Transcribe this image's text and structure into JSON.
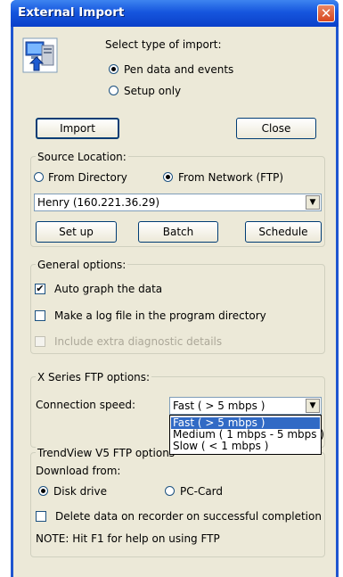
{
  "window": {
    "title": "External Import",
    "close_glyph": "✕"
  },
  "import_type": {
    "prompt": "Select type of import:",
    "options": [
      "Pen data and events",
      "Setup only"
    ],
    "selected": 0
  },
  "buttons": {
    "import": "Import",
    "close": "Close"
  },
  "source_location": {
    "label": "Source Location:",
    "from_directory": "From Directory",
    "from_network": "From Network (FTP)",
    "selected": "from_network",
    "server": "Henry (160.221.36.29)",
    "setup_btn": "Set up",
    "batch_btn": "Batch",
    "schedule_btn": "Schedule"
  },
  "general_options": {
    "label": "General options:",
    "auto_graph": {
      "label": "Auto graph the data",
      "checked": true
    },
    "log_file": {
      "label": "Make a log file in the program directory",
      "checked": false
    },
    "extra_diag": {
      "label": "Include extra diagnostic details",
      "checked": false,
      "disabled": true
    }
  },
  "x_series": {
    "label": "X Series FTP options:",
    "speed_label": "Connection speed:",
    "speed_value": "Fast ( > 5 mbps )",
    "speed_options": [
      "Fast ( > 5 mbps )",
      "Medium ( 1 mbps - 5 mbps )",
      "Slow ( < 1 mbps )"
    ]
  },
  "trendview": {
    "label": "TrendView V5 FTP options",
    "download_from": "Download from:",
    "disk_drive": "Disk drive",
    "pc_card": "PC-Card",
    "selected": "disk_drive",
    "delete_data": {
      "label": "Delete data on recorder on successful completion",
      "checked": false
    },
    "note": "NOTE: Hit F1 for help on using FTP"
  },
  "colors": {
    "title_bar": "#0a3fc9",
    "close_button": "#d8471e",
    "selection": "#316ac5",
    "face": "#ece9d8"
  },
  "icons": [
    "computer-import-icon",
    "chevron-down-icon"
  ]
}
